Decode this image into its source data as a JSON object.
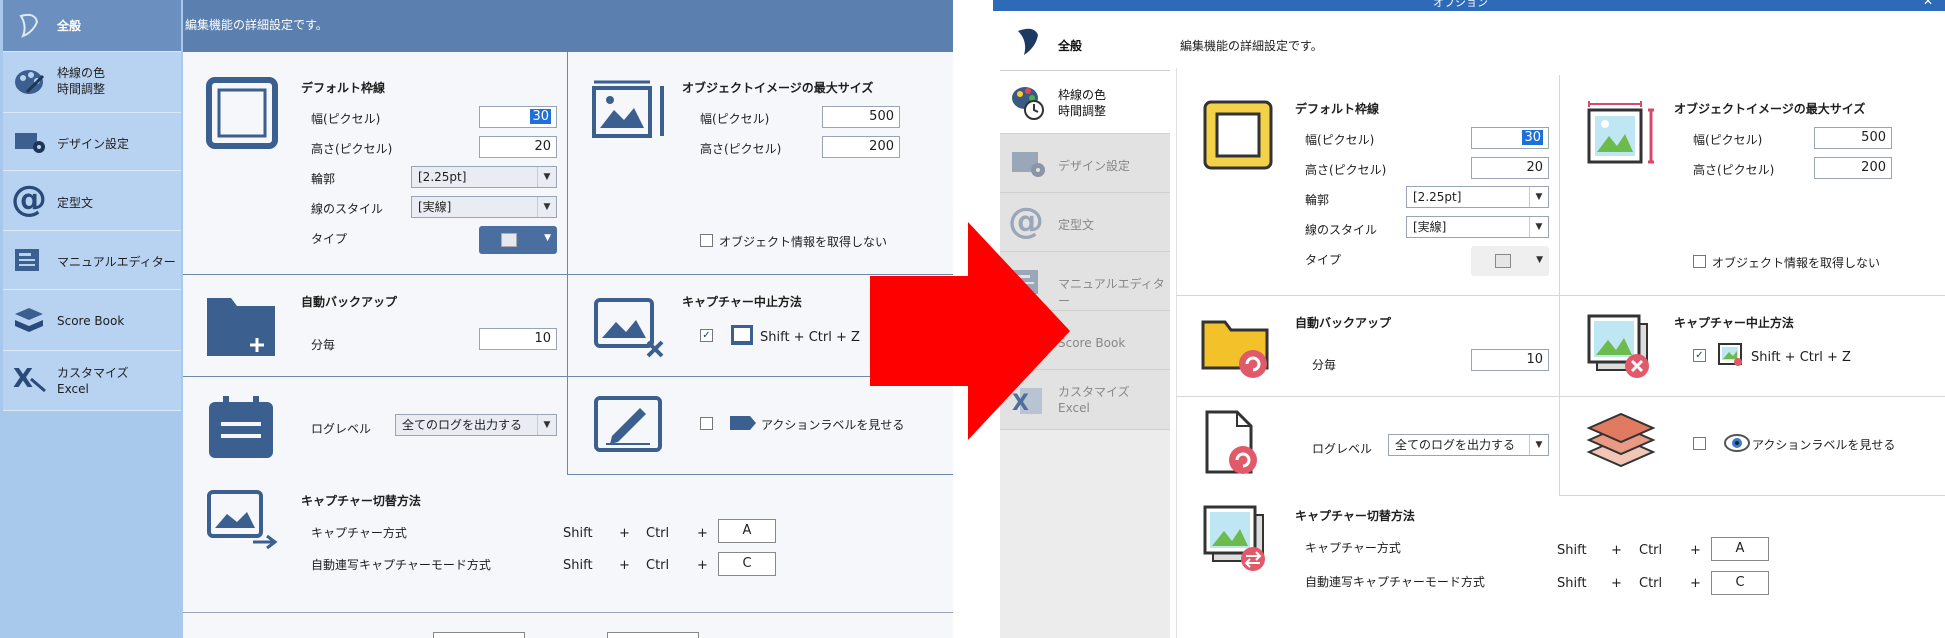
{
  "left": {
    "sidebar": [
      {
        "label": "全般"
      },
      {
        "label": "枠線の色\n時間調整"
      },
      {
        "label": "デザイン設定"
      },
      {
        "label": "定型文"
      },
      {
        "label": "マニュアルエディター"
      },
      {
        "label": "Score Book"
      },
      {
        "label": "カスタマイズ\nExcel"
      }
    ],
    "header": "編集機能の詳細設定です。",
    "default_border": {
      "title": "デフォルト枠線",
      "width_label": "幅(ピクセル)",
      "width_value": "30",
      "height_label": "高さ(ピクセル)",
      "height_value": "20",
      "outline_label": "輪郭",
      "outline_value": "[2.25pt]",
      "line_style_label": "線のスタイル",
      "line_style_value": "[実線]",
      "type_label": "タイプ"
    },
    "object_image": {
      "title": "オブジェクトイメージの最大サイズ",
      "width_label": "幅(ピクセル)",
      "width_value": "500",
      "height_label": "高さ(ピクセル)",
      "height_value": "200",
      "no_info_label": "オブジェクト情報を取得しない"
    },
    "auto_backup": {
      "title": "自動バックアップ",
      "interval_label": "分毎",
      "interval_value": "10"
    },
    "capture_stop": {
      "title": "キャプチャー中止方法",
      "shortcut": "Shift + Ctrl + Z"
    },
    "log": {
      "label": "ログレベル",
      "value": "全てのログを出力する"
    },
    "action_label": {
      "label": "アクションラベルを見せる"
    },
    "capture_switch": {
      "title": "キャプチャー切替方法",
      "rows": [
        {
          "label": "キャプチャー方式",
          "shift": "Shift",
          "plus1": "+",
          "ctrl": "Ctrl",
          "plus2": "+",
          "key": "A"
        },
        {
          "label": "自動連写キャプチャーモード方式",
          "shift": "Shift",
          "plus1": "+",
          "ctrl": "Ctrl",
          "plus2": "+",
          "key": "C"
        }
      ]
    }
  },
  "right": {
    "title": "オプション",
    "sidebar": [
      {
        "label": "全般"
      },
      {
        "label": "枠線の色\n時間調整"
      },
      {
        "label": "デザイン設定"
      },
      {
        "label": "定型文"
      },
      {
        "label": "マニュアルエディター"
      },
      {
        "label": "Score Book"
      },
      {
        "label": "カスタマイズ\nExcel"
      }
    ],
    "header": "編集機能の詳細設定です。",
    "default_border": {
      "title": "デフォルト枠線",
      "width_label": "幅(ピクセル)",
      "width_value": "30",
      "height_label": "高さ(ピクセル)",
      "height_value": "20",
      "outline_label": "輪郭",
      "outline_value": "[2.25pt]",
      "line_style_label": "線のスタイル",
      "line_style_value": "[実線]",
      "type_label": "タイプ"
    },
    "object_image": {
      "title": "オブジェクトイメージの最大サイズ",
      "width_label": "幅(ピクセル)",
      "width_value": "500",
      "height_label": "高さ(ピクセル)",
      "height_value": "200",
      "no_info_label": "オブジェクト情報を取得しない"
    },
    "auto_backup": {
      "title": "自動バックアップ",
      "interval_label": "分毎",
      "interval_value": "10"
    },
    "capture_stop": {
      "title": "キャプチャー中止方法",
      "shortcut": "Shift + Ctrl + Z"
    },
    "log": {
      "label": "ログレベル",
      "value": "全てのログを出力する"
    },
    "action_label": {
      "label": "アクションラベルを見せる"
    },
    "capture_switch": {
      "title": "キャプチャー切替方法",
      "rows": [
        {
          "label": "キャプチャー方式",
          "shift": "Shift",
          "plus1": "+",
          "ctrl": "Ctrl",
          "plus2": "+",
          "key": "A"
        },
        {
          "label": "自動連写キャプチャーモード方式",
          "shift": "Shift",
          "plus1": "+",
          "ctrl": "Ctrl",
          "plus2": "+",
          "key": "C"
        }
      ]
    }
  },
  "colors": {
    "arrow": "#ff0000",
    "left_sidebar": "#a9c9ec",
    "left_header": "#5b7fae",
    "right_titlebar": "#2d6ab7",
    "selection": "#1e6fd9"
  }
}
